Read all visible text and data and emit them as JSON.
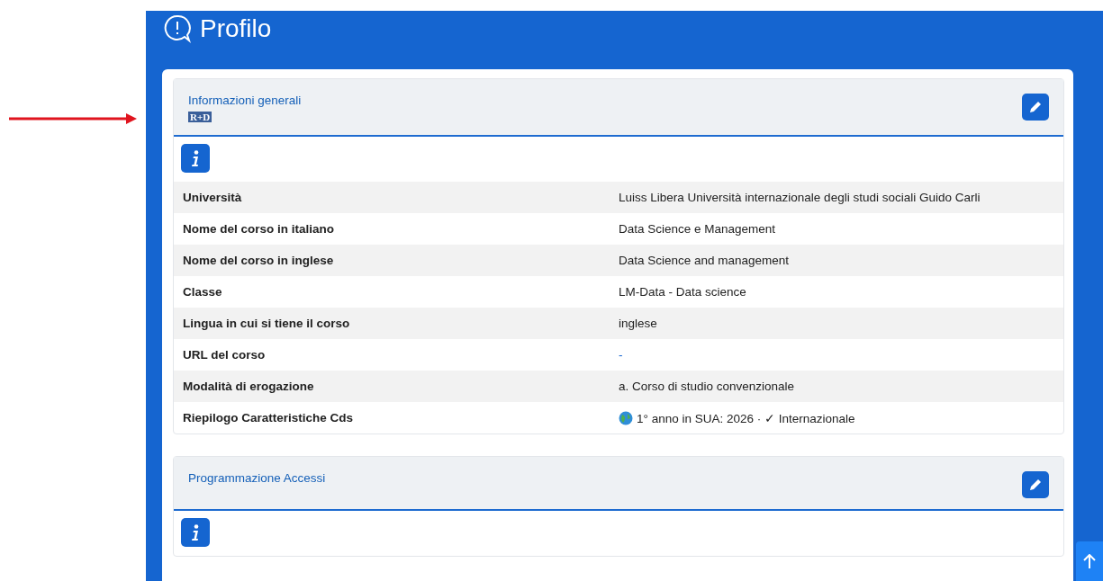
{
  "page": {
    "title": "Profilo"
  },
  "sections": [
    {
      "title": "Informazioni generali",
      "badge": "R+D",
      "rows": [
        {
          "label": "Università",
          "value": "Luiss Libera Università internazionale degli studi sociali Guido Carli",
          "kind": "text"
        },
        {
          "label": "Nome del corso in italiano",
          "value": "Data Science e Management",
          "kind": "text"
        },
        {
          "label": "Nome del corso in inglese",
          "value": "Data Science and management",
          "kind": "text"
        },
        {
          "label": "Classe",
          "value": "LM-Data - Data science",
          "kind": "text"
        },
        {
          "label": "Lingua in cui si tiene il corso",
          "value": "inglese",
          "kind": "text"
        },
        {
          "label": "URL del corso",
          "value": "-",
          "kind": "link"
        },
        {
          "label": "Modalità di erogazione",
          "value": "a. Corso di studio convenzionale",
          "kind": "text"
        },
        {
          "label": "Riepilogo Caratteristiche Cds",
          "value": "1° anno in SUA: 2026 · ✓ Internazionale",
          "kind": "globe"
        }
      ]
    },
    {
      "title": "Programmazione Accessi"
    }
  ]
}
